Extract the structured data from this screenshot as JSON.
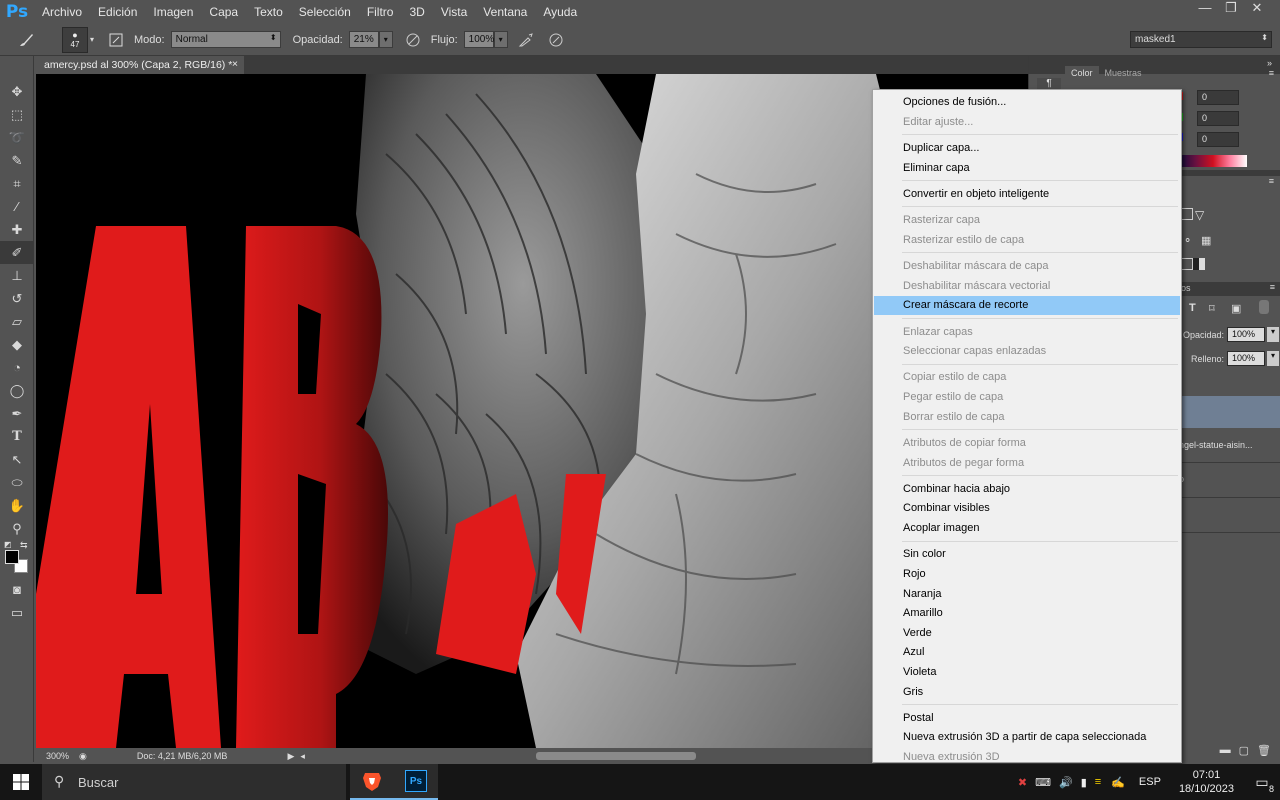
{
  "app": {
    "logo": "Ps",
    "menu": [
      "Archivo",
      "Edición",
      "Imagen",
      "Capa",
      "Texto",
      "Selección",
      "Filtro",
      "3D",
      "Vista",
      "Ventana",
      "Ayuda"
    ],
    "window_controls": [
      "—",
      "❐",
      "✕"
    ]
  },
  "options": {
    "brush_size": "47",
    "mode_label": "Modo:",
    "mode_value": "Normal",
    "opacity_label": "Opacidad:",
    "opacity_value": "21%",
    "flow_label": "Flujo:",
    "flow_value": "100%",
    "workspace": "masked1"
  },
  "document": {
    "tab_title": "amercy.psd al 300% (Capa 2, RGB/16) *",
    "close": "×",
    "zoom": "300%",
    "doc_size": "Doc: 4,21 MB/6,20 MB",
    "canvas_text": "ABA"
  },
  "panel": {
    "tab_color": "Color",
    "tab_swatches": "Muestras",
    "r": "0",
    "g": "0",
    "b": "0",
    "opacity_label": "Opacidad:",
    "opacity_value": "100%",
    "fill_label": "Relleno:",
    "fill_value": "100%",
    "layer_name": "ngel-statue-aisin...",
    "tab_layers_suffix": "os"
  },
  "context_menu": {
    "items": [
      {
        "label": "Opciones de fusión...",
        "disabled": false
      },
      {
        "label": "Editar ajuste...",
        "disabled": true
      },
      {
        "sep": true
      },
      {
        "label": "Duplicar capa...",
        "disabled": false
      },
      {
        "label": "Eliminar capa",
        "disabled": false
      },
      {
        "sep": true
      },
      {
        "label": "Convertir en objeto inteligente",
        "disabled": false
      },
      {
        "sep": true
      },
      {
        "label": "Rasterizar capa",
        "disabled": true
      },
      {
        "label": "Rasterizar estilo de capa",
        "disabled": true
      },
      {
        "sep": true
      },
      {
        "label": "Deshabilitar máscara de capa",
        "disabled": true
      },
      {
        "label": "Deshabilitar máscara vectorial",
        "disabled": true
      },
      {
        "label": "Crear máscara de recorte",
        "disabled": false,
        "highlight": true
      },
      {
        "sep": true
      },
      {
        "label": "Enlazar capas",
        "disabled": true
      },
      {
        "label": "Seleccionar capas enlazadas",
        "disabled": true
      },
      {
        "sep": true
      },
      {
        "label": "Copiar estilo de capa",
        "disabled": true
      },
      {
        "label": "Pegar estilo de capa",
        "disabled": true
      },
      {
        "label": "Borrar estilo de capa",
        "disabled": true
      },
      {
        "sep": true
      },
      {
        "label": "Atributos de copiar forma",
        "disabled": true
      },
      {
        "label": "Atributos de pegar forma",
        "disabled": true
      },
      {
        "sep": true
      },
      {
        "label": "Combinar hacia abajo",
        "disabled": false
      },
      {
        "label": "Combinar visibles",
        "disabled": false
      },
      {
        "label": "Acoplar imagen",
        "disabled": false
      },
      {
        "sep": true
      },
      {
        "label": "Sin color",
        "disabled": false
      },
      {
        "label": "Rojo",
        "disabled": false
      },
      {
        "label": "Naranja",
        "disabled": false
      },
      {
        "label": "Amarillo",
        "disabled": false
      },
      {
        "label": "Verde",
        "disabled": false
      },
      {
        "label": "Azul",
        "disabled": false
      },
      {
        "label": "Violeta",
        "disabled": false
      },
      {
        "label": "Gris",
        "disabled": false
      },
      {
        "sep": true
      },
      {
        "label": "Postal",
        "disabled": false
      },
      {
        "label": "Nueva extrusión 3D a partir de capa seleccionada",
        "disabled": false
      },
      {
        "label": "Nueva extrusión 3D",
        "disabled": true
      }
    ]
  },
  "taskbar": {
    "search_placeholder": "Buscar",
    "lang": "ESP",
    "time": "07:01",
    "date": "18/10/2023",
    "notifications": "8"
  },
  "colors": {
    "accent_red": "#e01b1b",
    "menu_highlight": "#91c9f7",
    "ps_blue": "#31a8ff"
  }
}
